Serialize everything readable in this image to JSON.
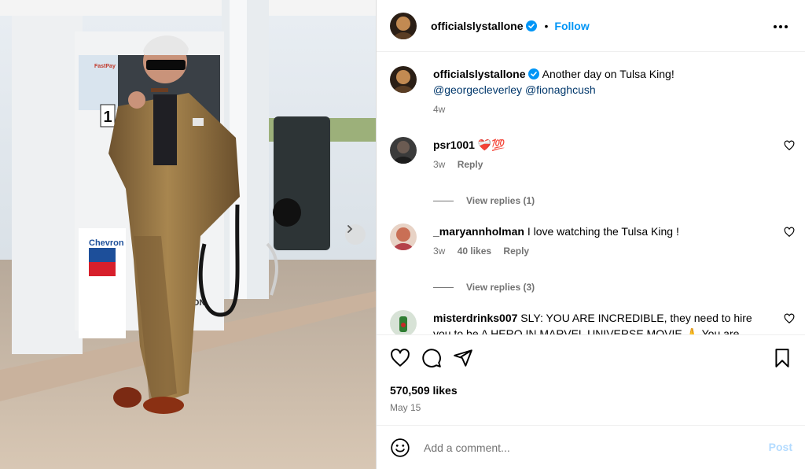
{
  "post": {
    "author": "officialslystallone",
    "follow_label": "Follow",
    "dot": "•",
    "caption": {
      "text": "Another day on Tulsa King!",
      "mention1": "@georgecleverley",
      "mention2": "@fionaghcush",
      "age": "4w"
    },
    "photo_text": {
      "brand": "Chevron",
      "pump_number": "1",
      "pay_label": "FastPay",
      "pump_side": "HRON"
    },
    "likes": "570,509 likes",
    "date": "May 15"
  },
  "comments": [
    {
      "user": "psr1001",
      "text": "",
      "emojis": "❤️‍🩹💯",
      "age": "3w",
      "likes": "",
      "reply": "Reply",
      "view_replies": "View replies (1)"
    },
    {
      "user": "_maryannholman",
      "text": "I love watching the Tulsa King !",
      "emojis": "",
      "age": "3w",
      "likes": "40 likes",
      "reply": "Reply",
      "view_replies": "View replies (3)"
    },
    {
      "user": "misterdrinks007",
      "text": "SLY: YOU ARE INCREDIBLE, they need to hire you to be A HERO IN MARVEL UNIVERSE MOVIE 🙏 You are",
      "emojis": "",
      "age": "",
      "likes": "",
      "reply": "",
      "view_replies": ""
    }
  ],
  "composer": {
    "placeholder": "Add a comment...",
    "post_label": "Post"
  },
  "icons": {
    "more": "more-options-icon",
    "like": "heart-icon",
    "comment": "comment-icon",
    "share": "share-icon",
    "save": "bookmark-icon",
    "emoji": "emoji-icon",
    "next": "chevron-right-icon",
    "verified": "verified-badge-icon"
  },
  "colors": {
    "accent": "#0095f6",
    "mention": "#00376b",
    "muted": "#737373",
    "post_disabled": "#b3dbff",
    "suit": "#9c7a45"
  }
}
